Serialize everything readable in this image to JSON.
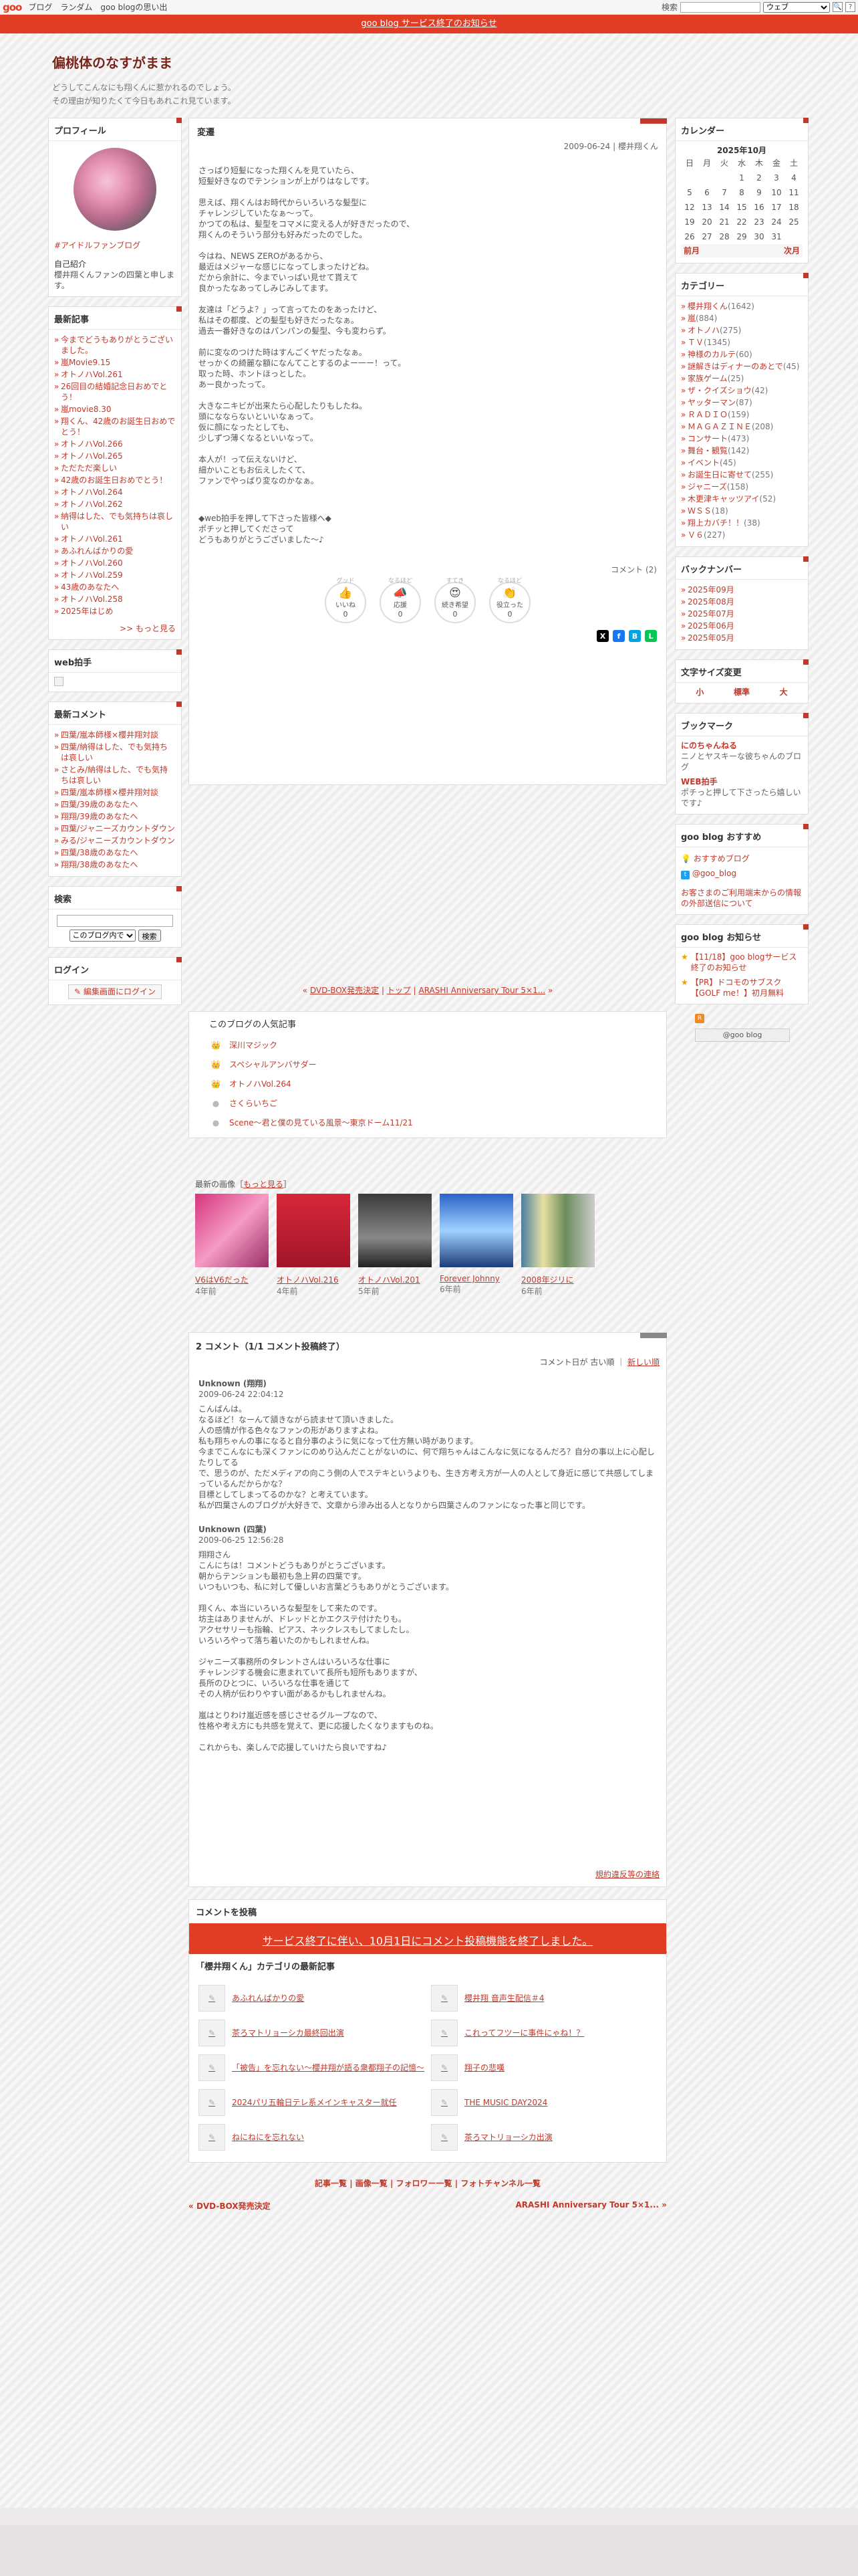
{
  "gnav": {
    "logo": "goo",
    "links": [
      "ブログ",
      "ランダム",
      "goo blogの思い出"
    ],
    "search_label": "検索",
    "search_scope": "ウェブ"
  },
  "banner": "goo blog サービス終了のお知らせ",
  "blog": {
    "title": "偏桃体のなすがまま",
    "desc1": "どうしてこんなにも翔くんに惹かれるのでしょう。",
    "desc2": "その理由が知りたくて今日もあれこれ見ています。"
  },
  "profile": {
    "title": "プロフィール",
    "link": "#アイドルファンブログ",
    "intro_h": "自己紹介",
    "intro": "櫻井翔くんファンの四葉と申します。"
  },
  "recent": {
    "title": "最新記事",
    "items": [
      "今までどうもありがとうございました。",
      "嵐Movie9.15",
      "オトノハVol.261",
      "26回目の結婚記念日おめでとう！",
      "嵐movie8.30",
      "翔くん、42歳のお誕生日おめでとう！",
      "オトノハVol.266",
      "オトノハVol.265",
      "ただただ楽しい",
      "42歳のお誕生日おめでとう！",
      "オトノハVol.264",
      "オトノハVol.262",
      "納得はした、でも気持ちは哀しい",
      "オトノハVol.261",
      "あふれんばかりの愛",
      "オトノハVol.260",
      "オトノハVol.259",
      "43歳のあなたへ",
      "オトノハVol.258",
      "2025年はじめ"
    ],
    "more": ">> もっと見る"
  },
  "web": {
    "title": "web拍手"
  },
  "rcomments": {
    "title": "最新コメント",
    "items": [
      "四葉/嵐本師様×櫻井翔対談",
      "四葉/納得はした、でも気持ちは哀しい",
      "さとみ/納得はした、でも気持ちは哀しい",
      "四葉/嵐本師様×櫻井翔対談",
      "四葉/39歳のあなたへ",
      "翔翔/39歳のあなたへ",
      "四葉/ジャニーズカウントダウン",
      "みる/ジャニーズカウントダウン",
      "四葉/38歳のあなたへ",
      "翔翔/38歳のあなたへ"
    ]
  },
  "search": {
    "title": "検索",
    "scope": "このブログ内で",
    "btn": "検索"
  },
  "login": {
    "title": "ログイン",
    "btn": "編集画面にログイン"
  },
  "calendar": {
    "title": "カレンダー",
    "month": "2025年10月",
    "days": [
      "日",
      "月",
      "火",
      "水",
      "木",
      "金",
      "土"
    ],
    "rows": [
      [
        "",
        "",
        "",
        "1",
        "2",
        "3",
        "4"
      ],
      [
        "5",
        "6",
        "7",
        "8",
        "9",
        "10",
        "11"
      ],
      [
        "12",
        "13",
        "14",
        "15",
        "16",
        "17",
        "18"
      ],
      [
        "19",
        "20",
        "21",
        "22",
        "23",
        "24",
        "25"
      ],
      [
        "26",
        "27",
        "28",
        "29",
        "30",
        "31",
        ""
      ]
    ],
    "prev": "前月",
    "next": "次月"
  },
  "categories": {
    "title": "カテゴリー",
    "items": [
      [
        "櫻井翔くん",
        "(1642)"
      ],
      [
        "嵐",
        "(884)"
      ],
      [
        "オトノハ",
        "(275)"
      ],
      [
        "ＴＶ",
        "(1345)"
      ],
      [
        "神様のカルテ",
        "(60)"
      ],
      [
        "謎解きはディナーのあとで",
        "(45)"
      ],
      [
        "家族ゲーム",
        "(25)"
      ],
      [
        "ザ・クイズショウ",
        "(42)"
      ],
      [
        "ヤッターマン",
        "(87)"
      ],
      [
        "ＲＡＤＩＯ",
        "(159)"
      ],
      [
        "ＭＡＧＡＺＩＮＥ",
        "(208)"
      ],
      [
        "コンサート",
        "(473)"
      ],
      [
        "舞台・観覧",
        "(142)"
      ],
      [
        "イベント",
        "(45)"
      ],
      [
        "お誕生日に寄せて",
        "(255)"
      ],
      [
        "ジャニーズ",
        "(158)"
      ],
      [
        "木更津キャッツアイ",
        "(52)"
      ],
      [
        "ＷＳＳ",
        "(18)"
      ],
      [
        "翔上カバチ！！",
        "(38)"
      ],
      [
        "Ｖ６",
        "(227)"
      ]
    ]
  },
  "backnumber": {
    "title": "バックナンバー",
    "items": [
      "2025年09月",
      "2025年08月",
      "2025年07月",
      "2025年06月",
      "2025年05月"
    ]
  },
  "textsize": {
    "title": "文字サイズ変更",
    "small": "小",
    "normal": "標準",
    "large": "大"
  },
  "bookmark": {
    "title": "ブックマーク",
    "items": [
      {
        "name": "にのちゃんねる",
        "desc": "ニノとヤスキーな彼ちゃんのブログ"
      },
      {
        "name": "WEB拍手",
        "desc": "ポチっと押して下さったら嬉しいです♪"
      }
    ]
  },
  "goosum": {
    "title": "goo blog おすすめ",
    "items": [
      "おすすめブログ",
      "@goo_blog"
    ],
    "note": "お客さまのご利用端末からの情報の外部送信について"
  },
  "gooinfo": {
    "title": "goo blog お知らせ",
    "items": [
      "【11/18】goo blogサービス終了のお知らせ",
      "【PR】ドコモのサブスク【GOLF me！】初月無料"
    ]
  },
  "goobtn": "@goo blog",
  "entry": {
    "title": "変遷",
    "meta": "2009-06-24 | 櫻井翔くん",
    "paras": [
      [
        "さっぱり短髪になった翔くんを見ていたら、",
        "短髪好きなのでテンションが上がりはなしです。"
      ],
      [
        "思えば、翔くんはお時代からいろいろな髪型に",
        "チャレンジしていたなぁ～って。",
        "かつての私は、髪型をコマメに変える人が好きだったので、",
        "翔くんのそういう部分も好みだったのでした。"
      ],
      [
        "今はね、NEWS ZEROがあるから、",
        "最近はメジャーな感じになってしまったけどね。",
        "だから余計に、今までいっぱい見せて貰えて",
        "良かったなあってしみじみしてます。"
      ],
      [
        "友達は「どうよ？」って言ってたのをあったけど、",
        "私はその都度、どの髪型も好きだったなぁ。",
        "過去一番好きなのはパンパンの髪型、今も変わらず。"
      ],
      [
        "前に変なのつけた時はすんごくヤだったなぁ。",
        "せっかくの綺麗な額になんてことするのよー一ー！って。",
        "取った時、ホントほっとした。",
        "あー良かったって。"
      ],
      [
        "大きなニキビが出来たら心配したりもしたね。",
        "頭になならないといいなぁって。",
        "仮に顔になったとしても、",
        "少しずつ薄くなるといいなって。"
      ],
      [
        "本人が！って伝えないけど、",
        "細かいこともお伝えしたくて、",
        "ファンでやっぱり変なのかなぁ。"
      ],
      [
        "◆web拍手を押して下さった皆様へ◆",
        "ポチッと押してくださって",
        "どうもありがとうございました～♪"
      ]
    ],
    "comment_count": "コメント (2)"
  },
  "reactions": [
    {
      "cap": "グッド",
      "emo": "👍",
      "label": "いいね",
      "n": "0"
    },
    {
      "cap": "なるほど",
      "emo": "📣",
      "label": "応援",
      "n": "0"
    },
    {
      "cap": "すてき",
      "emo": "😍",
      "label": "続き希望",
      "n": "0"
    },
    {
      "cap": "なるほど",
      "emo": "👏",
      "label": "役立った",
      "n": "0"
    }
  ],
  "pager": {
    "prev": "DVD-BOX発売決定",
    "top": "トップ",
    "next": "ARASHI Anniversary Tour 5×1..."
  },
  "popular": {
    "title": "このブログの人気記事",
    "items": [
      "深川マジック",
      "スペシャルアンバサダー",
      "オトノハVol.264",
      "さくらいちご",
      "Scene〜君と僕の見ている風景〜東京ドーム11/21"
    ]
  },
  "latest": {
    "title": "最新の画像",
    "more": "もっと見る",
    "items": [
      {
        "cap": "V6はV6だった",
        "age": "4年前"
      },
      {
        "cap": "オトノハVol.216",
        "age": "4年前"
      },
      {
        "cap": "オトノハVol.201",
        "age": "5年前"
      },
      {
        "cap": "Forever Johnny",
        "age": "6年前"
      },
      {
        "cap": "2008年ジリに",
        "age": "6年前"
      }
    ]
  },
  "comments": {
    "title": "2 コメント（1/1 コメント投稿終了）",
    "sort": "コメント日が 古い順",
    "sort_new": "新しい順",
    "items": [
      {
        "name": "Unknown (翔翔)",
        "date": "2009-06-24 22:04:12",
        "lines": [
          "こんばんは。",
          "なるほど！なーんて頷きながら読ませて頂いきました。",
          "人の感情が作る色々なファンの形がありますよね。",
          "私も翔ちゃんの事になると自分事のように気になって仕方無い時があります。",
          "今までこんなにも深くファンにのめり込んだことがないのに、何で翔ちゃんはこんなに気になるんだろ？自分の事以上に心配したりしてる",
          "で、思うのが、ただメディアの向こう側の人でステキというよりも、生き方考え方が一人の人として身近に感じて共感してしまっているんだからかな？",
          "目標としてしまってるのかな？と考えています。",
          "私が四葉さんのブログが大好きで、文章から滲み出る人となりから四葉さんのファンになった事と同じです。"
        ]
      },
      {
        "name": "Unknown (四葉)",
        "date": "2009-06-25 12:56:28",
        "lines": [
          "翔翔さん",
          "こんにちは！コメントどうもありがとうございます。",
          "朝からテンションも最初も急上昇の四葉です。",
          "いつもいつも、私に対して優しいお言葉どうもありがとうございます。",
          "",
          "翔くん、本当にいろいろな髪型をして来たのです。",
          "坊主はありませんが、ドレッドとかエクステ付けたりも。",
          "アクセサリーも指輪、ピアス、ネックレスもしてましたし。",
          "いろいろやって落ち着いたのかもしれませんね。",
          "",
          "ジャニーズ事務所のタレントさんはいろいろな仕事に",
          "チャレンジする機会に恵まれていて長所も短所もありますが、",
          "長所のひとつに、いろいろな仕事を通じて",
          "その人柄が伝わりやすい面があるかもしれませんね。",
          "",
          "嵐はとりわけ嵐近感を感じさせるグループなので、",
          "性格や考え方にも共感を覚えて、更に応援したくなりますものね。",
          "",
          "これからも、楽しんで応援していけたら良いですね♪"
        ]
      }
    ],
    "report": "規約違反等の連絡"
  },
  "post": {
    "title": "コメントを投稿",
    "notice": "サービス終了に伴い、10月1日にコメント投稿機能を終了しました。"
  },
  "catlatest": {
    "title": "「櫻井翔くん」カテゴリの最新記事",
    "items": [
      "あふれんばかりの愛",
      "櫻井翔 音声生配信＃4",
      "茶ろマトリョーシカ最終回出演",
      "これってフツーに事件にゃね！？",
      "「被告」を忘れない〜櫻井翔が語る衆都翔子の記憶〜",
      "翔子の悲嘆",
      "2024パリ五輪日テレ系メインキャスター就任",
      "THE MUSIC DAY2024",
      "ねにねにを忘れない",
      "茶ろマトリョーシカ出演"
    ]
  },
  "footnav": {
    "links": [
      "記事一覧",
      "画像一覧",
      "フォロワー一覧",
      "フォトチャンネル一覧"
    ],
    "prev": "DVD-BOX発売決定",
    "next": "ARASHI Anniversary Tour 5×1..."
  }
}
